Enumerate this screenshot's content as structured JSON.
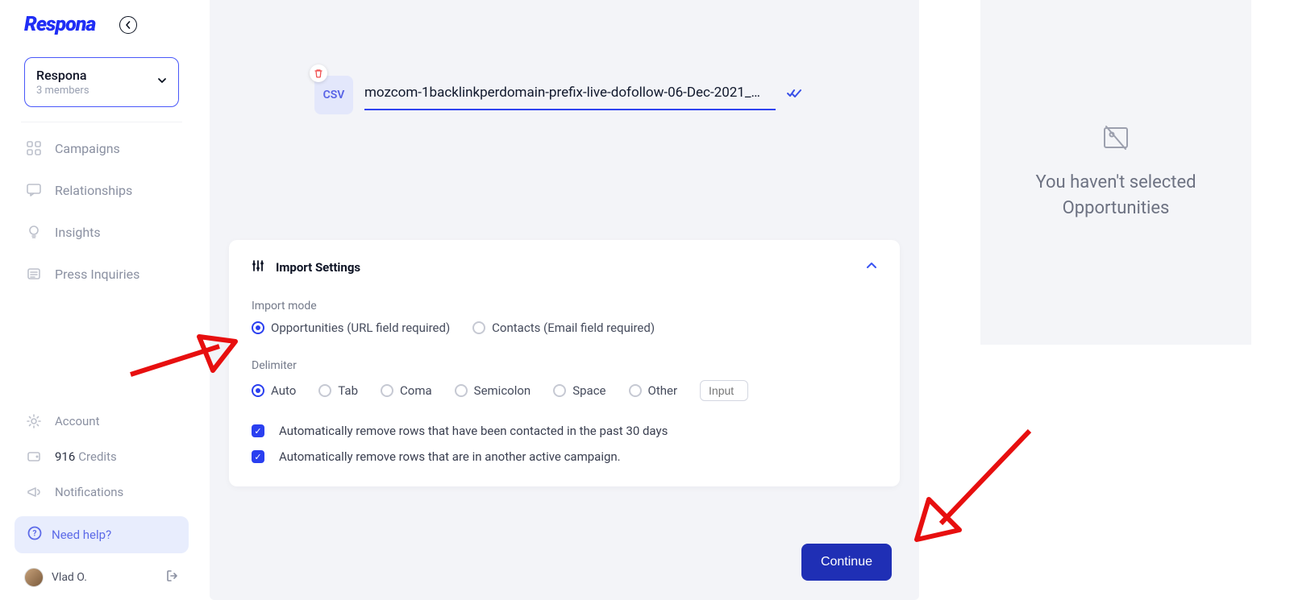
{
  "brand": {
    "name": "Respona"
  },
  "workspace": {
    "name": "Respona",
    "members_label": "3 members"
  },
  "nav": {
    "primary": [
      {
        "label": "Campaigns",
        "icon": "grid-icon"
      },
      {
        "label": "Relationships",
        "icon": "chat-icon"
      },
      {
        "label": "Insights",
        "icon": "bulb-icon"
      },
      {
        "label": "Press Inquiries",
        "icon": "press-icon"
      }
    ],
    "secondary": {
      "account_label": "Account",
      "credits_count": "916",
      "credits_label": "Credits",
      "notifications_label": "Notifications",
      "help_label": "Need help?"
    }
  },
  "user": {
    "display_name": "Vlad O."
  },
  "file": {
    "badge": "CSV",
    "name": "mozcom-1backlinkperdomain-prefix-live-dofollow-06-Dec-2021_…"
  },
  "settings": {
    "title": "Import Settings",
    "mode_label": "Import mode",
    "modes": {
      "opportunities": "Opportunities (URL field required)",
      "contacts": "Contacts (Email field required)"
    },
    "delimiter_label": "Delimiter",
    "delimiters": {
      "auto": "Auto",
      "tab": "Tab",
      "coma": "Coma",
      "semicolon": "Semicolon",
      "space": "Space",
      "other": "Other",
      "other_placeholder": "Input"
    },
    "check1": "Automatically remove rows that have been contacted in the past 30 days",
    "check2": "Automatically remove rows that are in another active campaign.",
    "continue_label": "Continue"
  },
  "right": {
    "empty_text": "You haven't selected Opportunities"
  }
}
